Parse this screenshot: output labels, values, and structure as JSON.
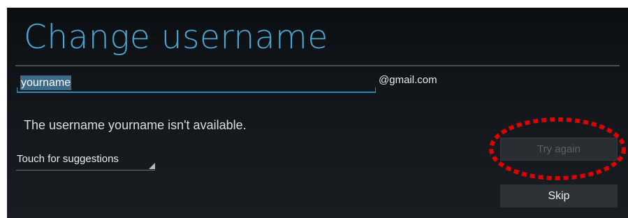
{
  "page": {
    "title": "Change username"
  },
  "username_field": {
    "value": "yourname",
    "domain_suffix": "@gmail.com"
  },
  "status": {
    "message": "The username yourname isn't available."
  },
  "suggestions": {
    "label": "Touch for suggestions"
  },
  "buttons": {
    "try_again": "Try again",
    "try_again_enabled": false,
    "skip": "Skip"
  },
  "annotation": {
    "type": "red-dashed-ellipse",
    "target": "try-again-button",
    "color": "#e00000"
  },
  "colors": {
    "title": "#4aa6d4",
    "accent": "#2e88b8",
    "background": "#111417"
  }
}
